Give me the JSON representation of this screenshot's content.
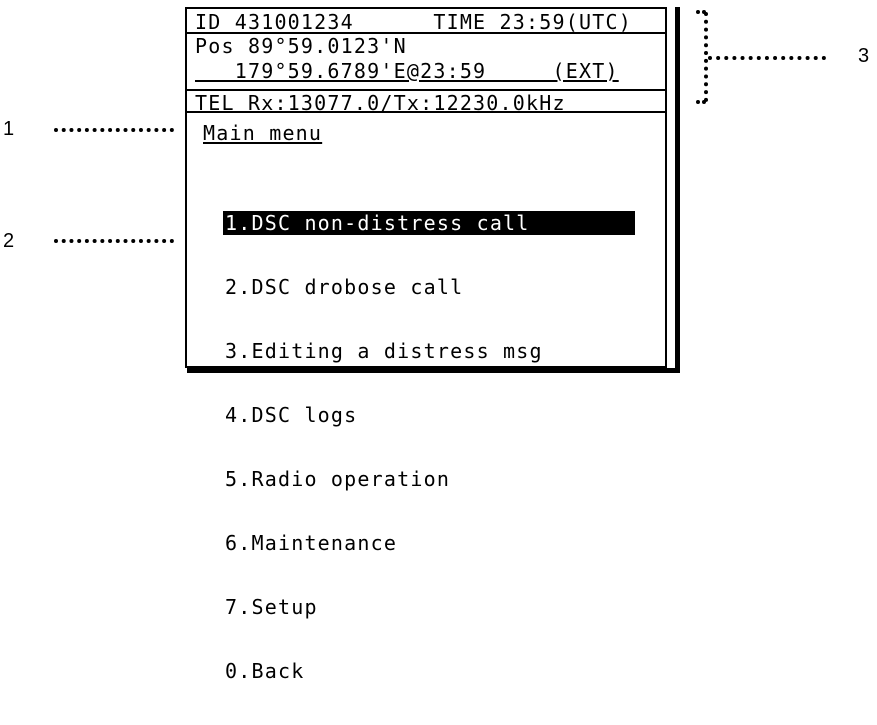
{
  "status": {
    "id_line": "ID 431001234      TIME 23:59(UTC)",
    "pos_line1": "Pos 89°59.0123'N",
    "pos_line2": "   179°59.6789'E@23:59     (EXT)",
    "tel_line": "TEL Rx:13077.0/Tx:12230.0kHz"
  },
  "menu": {
    "title": "Main menu",
    "items": [
      "1.DSC non-distress call",
      "2.DSC drobose call",
      "3.Editing a distress msg",
      "4.DSC logs",
      "5.Radio operation",
      "6.Maintenance",
      "7.Setup",
      "0.Back"
    ],
    "selected_index": 0
  },
  "callouts": {
    "c1": "1",
    "c2": "2",
    "c3": "3"
  }
}
